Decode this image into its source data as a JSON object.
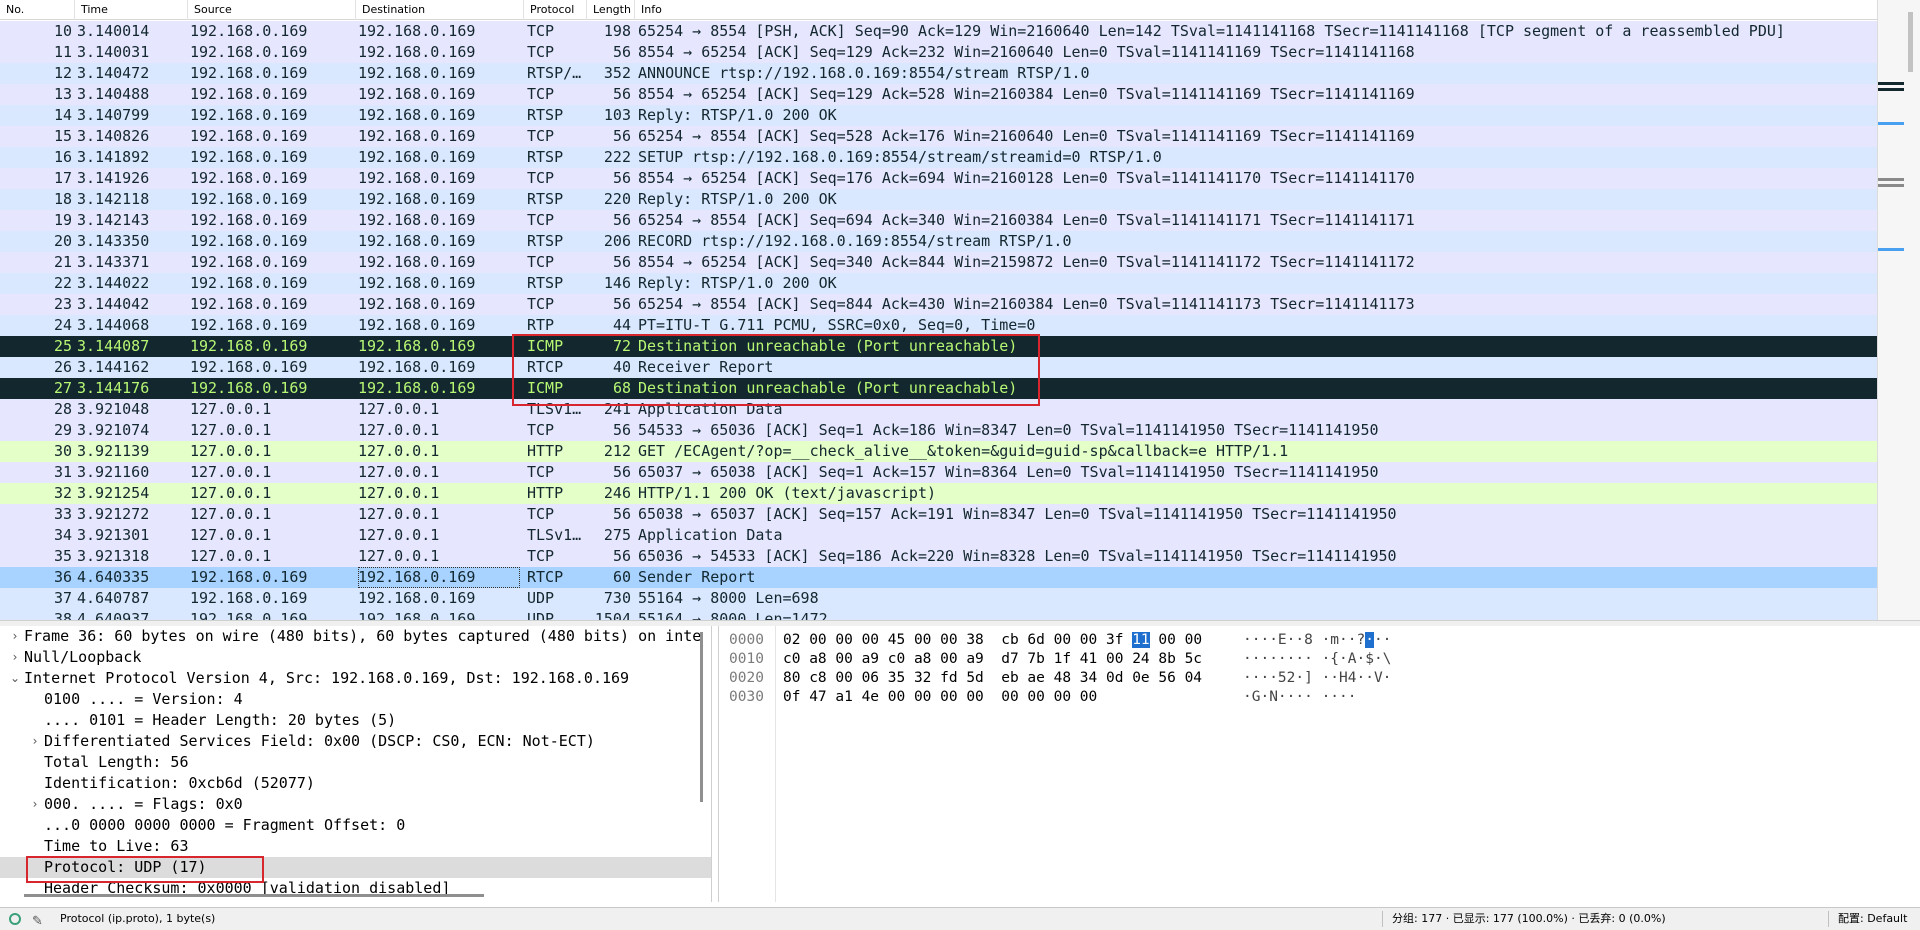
{
  "columns": {
    "no": "No.",
    "time": "Time",
    "source": "Source",
    "destination": "Destination",
    "protocol": "Protocol",
    "length": "Length",
    "info": "Info"
  },
  "colors": {
    "tcp_bg": "#e7e6ff",
    "rtsp_bg": "#dae8ff",
    "http_bg": "#e4ffc7",
    "icmp_bg": "#12272e",
    "icmp_fg": "#b7f774",
    "selected_bg": "#a8d2ff",
    "highlight_box": "#d8262e"
  },
  "packets": [
    {
      "no": "10",
      "time": "3.140014",
      "src": "192.168.0.169",
      "dst": "192.168.0.169",
      "proto": "TCP",
      "len": "198",
      "info": "65254 → 8554 [PSH, ACK] Seq=90 Ack=129 Win=2160640 Len=142 TSval=1141141168 TSecr=1141141168 [TCP segment of a reassembled PDU]",
      "bg": "#e7e6ff",
      "fg": "#12272e"
    },
    {
      "no": "11",
      "time": "3.140031",
      "src": "192.168.0.169",
      "dst": "192.168.0.169",
      "proto": "TCP",
      "len": "56",
      "info": "8554 → 65254 [ACK] Seq=129 Ack=232 Win=2160640 Len=0 TSval=1141141169 TSecr=1141141168",
      "bg": "#e7e6ff",
      "fg": "#12272e"
    },
    {
      "no": "12",
      "time": "3.140472",
      "src": "192.168.0.169",
      "dst": "192.168.0.169",
      "proto": "RTSP/…",
      "len": "352",
      "info": "ANNOUNCE rtsp://192.168.0.169:8554/stream RTSP/1.0",
      "bg": "#dae8ff",
      "fg": "#12272e"
    },
    {
      "no": "13",
      "time": "3.140488",
      "src": "192.168.0.169",
      "dst": "192.168.0.169",
      "proto": "TCP",
      "len": "56",
      "info": "8554 → 65254 [ACK] Seq=129 Ack=528 Win=2160384 Len=0 TSval=1141141169 TSecr=1141141169",
      "bg": "#e7e6ff",
      "fg": "#12272e"
    },
    {
      "no": "14",
      "time": "3.140799",
      "src": "192.168.0.169",
      "dst": "192.168.0.169",
      "proto": "RTSP",
      "len": "103",
      "info": "Reply: RTSP/1.0 200 OK",
      "bg": "#dae8ff",
      "fg": "#12272e"
    },
    {
      "no": "15",
      "time": "3.140826",
      "src": "192.168.0.169",
      "dst": "192.168.0.169",
      "proto": "TCP",
      "len": "56",
      "info": "65254 → 8554 [ACK] Seq=528 Ack=176 Win=2160640 Len=0 TSval=1141141169 TSecr=1141141169",
      "bg": "#e7e6ff",
      "fg": "#12272e"
    },
    {
      "no": "16",
      "time": "3.141892",
      "src": "192.168.0.169",
      "dst": "192.168.0.169",
      "proto": "RTSP",
      "len": "222",
      "info": "SETUP rtsp://192.168.0.169:8554/stream/streamid=0 RTSP/1.0",
      "bg": "#dae8ff",
      "fg": "#12272e"
    },
    {
      "no": "17",
      "time": "3.141926",
      "src": "192.168.0.169",
      "dst": "192.168.0.169",
      "proto": "TCP",
      "len": "56",
      "info": "8554 → 65254 [ACK] Seq=176 Ack=694 Win=2160128 Len=0 TSval=1141141170 TSecr=1141141170",
      "bg": "#e7e6ff",
      "fg": "#12272e"
    },
    {
      "no": "18",
      "time": "3.142118",
      "src": "192.168.0.169",
      "dst": "192.168.0.169",
      "proto": "RTSP",
      "len": "220",
      "info": "Reply: RTSP/1.0 200 OK",
      "bg": "#dae8ff",
      "fg": "#12272e"
    },
    {
      "no": "19",
      "time": "3.142143",
      "src": "192.168.0.169",
      "dst": "192.168.0.169",
      "proto": "TCP",
      "len": "56",
      "info": "65254 → 8554 [ACK] Seq=694 Ack=340 Win=2160384 Len=0 TSval=1141141171 TSecr=1141141171",
      "bg": "#e7e6ff",
      "fg": "#12272e"
    },
    {
      "no": "20",
      "time": "3.143350",
      "src": "192.168.0.169",
      "dst": "192.168.0.169",
      "proto": "RTSP",
      "len": "206",
      "info": "RECORD rtsp://192.168.0.169:8554/stream RTSP/1.0",
      "bg": "#dae8ff",
      "fg": "#12272e"
    },
    {
      "no": "21",
      "time": "3.143371",
      "src": "192.168.0.169",
      "dst": "192.168.0.169",
      "proto": "TCP",
      "len": "56",
      "info": "8554 → 65254 [ACK] Seq=340 Ack=844 Win=2159872 Len=0 TSval=1141141172 TSecr=1141141172",
      "bg": "#e7e6ff",
      "fg": "#12272e"
    },
    {
      "no": "22",
      "time": "3.144022",
      "src": "192.168.0.169",
      "dst": "192.168.0.169",
      "proto": "RTSP",
      "len": "146",
      "info": "Reply: RTSP/1.0 200 OK",
      "bg": "#dae8ff",
      "fg": "#12272e"
    },
    {
      "no": "23",
      "time": "3.144042",
      "src": "192.168.0.169",
      "dst": "192.168.0.169",
      "proto": "TCP",
      "len": "56",
      "info": "65254 → 8554 [ACK] Seq=844 Ack=430 Win=2160384 Len=0 TSval=1141141173 TSecr=1141141173",
      "bg": "#e7e6ff",
      "fg": "#12272e"
    },
    {
      "no": "24",
      "time": "3.144068",
      "src": "192.168.0.169",
      "dst": "192.168.0.169",
      "proto": "RTP",
      "len": "44",
      "info": "PT=ITU-T G.711 PCMU, SSRC=0x0, Seq=0, Time=0",
      "bg": "#dae8ff",
      "fg": "#12272e"
    },
    {
      "no": "25",
      "time": "3.144087",
      "src": "192.168.0.169",
      "dst": "192.168.0.169",
      "proto": "ICMP",
      "len": "72",
      "info": "Destination unreachable (Port unreachable)",
      "bg": "#12272e",
      "fg": "#b7f774"
    },
    {
      "no": "26",
      "time": "3.144162",
      "src": "192.168.0.169",
      "dst": "192.168.0.169",
      "proto": "RTCP",
      "len": "40",
      "info": "Receiver Report",
      "bg": "#dae8ff",
      "fg": "#12272e"
    },
    {
      "no": "27",
      "time": "3.144176",
      "src": "192.168.0.169",
      "dst": "192.168.0.169",
      "proto": "ICMP",
      "len": "68",
      "info": "Destination unreachable (Port unreachable)",
      "bg": "#12272e",
      "fg": "#b7f774"
    },
    {
      "no": "28",
      "time": "3.921048",
      "src": "127.0.0.1",
      "dst": "127.0.0.1",
      "proto": "TLSv1…",
      "len": "241",
      "info": "Application Data",
      "bg": "#e7e6ff",
      "fg": "#12272e"
    },
    {
      "no": "29",
      "time": "3.921074",
      "src": "127.0.0.1",
      "dst": "127.0.0.1",
      "proto": "TCP",
      "len": "56",
      "info": "54533 → 65036 [ACK] Seq=1 Ack=186 Win=8347 Len=0 TSval=1141141950 TSecr=1141141950",
      "bg": "#e7e6ff",
      "fg": "#12272e"
    },
    {
      "no": "30",
      "time": "3.921139",
      "src": "127.0.0.1",
      "dst": "127.0.0.1",
      "proto": "HTTP",
      "len": "212",
      "info": "GET /ECAgent/?op=__check_alive__&token=&guid=guid-sp&callback=e HTTP/1.1",
      "bg": "#e4ffc7",
      "fg": "#12272e"
    },
    {
      "no": "31",
      "time": "3.921160",
      "src": "127.0.0.1",
      "dst": "127.0.0.1",
      "proto": "TCP",
      "len": "56",
      "info": "65037 → 65038 [ACK] Seq=1 Ack=157 Win=8364 Len=0 TSval=1141141950 TSecr=1141141950",
      "bg": "#e7e6ff",
      "fg": "#12272e"
    },
    {
      "no": "32",
      "time": "3.921254",
      "src": "127.0.0.1",
      "dst": "127.0.0.1",
      "proto": "HTTP",
      "len": "246",
      "info": "HTTP/1.1 200 OK  (text/javascript)",
      "bg": "#e4ffc7",
      "fg": "#12272e"
    },
    {
      "no": "33",
      "time": "3.921272",
      "src": "127.0.0.1",
      "dst": "127.0.0.1",
      "proto": "TCP",
      "len": "56",
      "info": "65038 → 65037 [ACK] Seq=157 Ack=191 Win=8347 Len=0 TSval=1141141950 TSecr=1141141950",
      "bg": "#e7e6ff",
      "fg": "#12272e"
    },
    {
      "no": "34",
      "time": "3.921301",
      "src": "127.0.0.1",
      "dst": "127.0.0.1",
      "proto": "TLSv1…",
      "len": "275",
      "info": "Application Data",
      "bg": "#e7e6ff",
      "fg": "#12272e"
    },
    {
      "no": "35",
      "time": "3.921318",
      "src": "127.0.0.1",
      "dst": "127.0.0.1",
      "proto": "TCP",
      "len": "56",
      "info": "65036 → 54533 [ACK] Seq=186 Ack=220 Win=8328 Len=0 TSval=1141141950 TSecr=1141141950",
      "bg": "#e7e6ff",
      "fg": "#12272e"
    },
    {
      "no": "36",
      "time": "4.640335",
      "src": "192.168.0.169",
      "dst": "192.168.0.169",
      "proto": "RTCP",
      "len": "60",
      "info": "Sender Report",
      "bg": "#a8d2ff",
      "fg": "#12272e",
      "selected": true
    },
    {
      "no": "37",
      "time": "4.640787",
      "src": "192.168.0.169",
      "dst": "192.168.0.169",
      "proto": "UDP",
      "len": "730",
      "info": "55164 → 8000 Len=698",
      "bg": "#dae8ff",
      "fg": "#12272e"
    },
    {
      "no": "38",
      "time": "4.640937",
      "src": "192.168.0.169",
      "dst": "192.168.0.169",
      "proto": "UDP",
      "len": "1504",
      "info": "55164 → 8000 Len=1472",
      "bg": "#dae8ff",
      "fg": "#12272e"
    }
  ],
  "details": [
    {
      "depth": 0,
      "arrow": "›",
      "text": "Frame 36: 60 bytes on wire (480 bits), 60 bytes captured (480 bits) on inte"
    },
    {
      "depth": 0,
      "arrow": "›",
      "text": "Null/Loopback"
    },
    {
      "depth": 0,
      "arrow": "⌄",
      "text": "Internet Protocol Version 4, Src: 192.168.0.169, Dst: 192.168.0.169"
    },
    {
      "depth": 1,
      "arrow": "",
      "text": "0100 .... = Version: 4"
    },
    {
      "depth": 1,
      "arrow": "",
      "text": ".... 0101 = Header Length: 20 bytes (5)"
    },
    {
      "depth": 1,
      "arrow": "›",
      "text": "Differentiated Services Field: 0x00 (DSCP: CS0, ECN: Not-ECT)"
    },
    {
      "depth": 1,
      "arrow": "",
      "text": "Total Length: 56"
    },
    {
      "depth": 1,
      "arrow": "",
      "text": "Identification: 0xcb6d (52077)"
    },
    {
      "depth": 1,
      "arrow": "›",
      "text": "000. .... = Flags: 0x0"
    },
    {
      "depth": 1,
      "arrow": "",
      "text": "...0 0000 0000 0000 = Fragment Offset: 0"
    },
    {
      "depth": 1,
      "arrow": "",
      "text": "Time to Live: 63"
    },
    {
      "depth": 1,
      "arrow": "",
      "text": "Protocol: UDP (17)",
      "highlight": true
    },
    {
      "depth": 1,
      "arrow": "",
      "text": "Header Checksum: 0x0000 [validation disabled]"
    }
  ],
  "bytes": [
    {
      "offset": "0000",
      "hex_pre": "02 00 00 00 45 00 00 38  cb 6d 00 00 3f ",
      "hex_sel": "11",
      "hex_post": " 00 00",
      "ascii_pre": "····E··8 ·m··?",
      "ascii_sel": "·",
      "ascii_post": "··"
    },
    {
      "offset": "0010",
      "hex_pre": "c0 a8 00 a9 c0 a8 00 a9  d7 7b 1f 41 00 24 8b 5c",
      "hex_sel": "",
      "hex_post": "",
      "ascii_pre": "········ ·{·A·$·\\",
      "ascii_sel": "",
      "ascii_post": ""
    },
    {
      "offset": "0020",
      "hex_pre": "80 c8 00 06 35 32 fd 5d  eb ae 48 34 0d 0e 56 04",
      "hex_sel": "",
      "hex_post": "",
      "ascii_pre": "····52·] ··H4··V·",
      "ascii_sel": "",
      "ascii_post": ""
    },
    {
      "offset": "0030",
      "hex_pre": "0f 47 a1 4e 00 00 00 00  00 00 00 00",
      "hex_sel": "",
      "hex_post": "",
      "ascii_pre": "·G·N···· ····",
      "ascii_sel": "",
      "ascii_post": ""
    }
  ],
  "status": {
    "field": "Protocol (ip.proto), 1 byte(s)",
    "counts": "分组: 177 · 已显示: 177 (100.0%) · 已丢弃: 0 (0.0%)",
    "profile": "配置: Default"
  }
}
